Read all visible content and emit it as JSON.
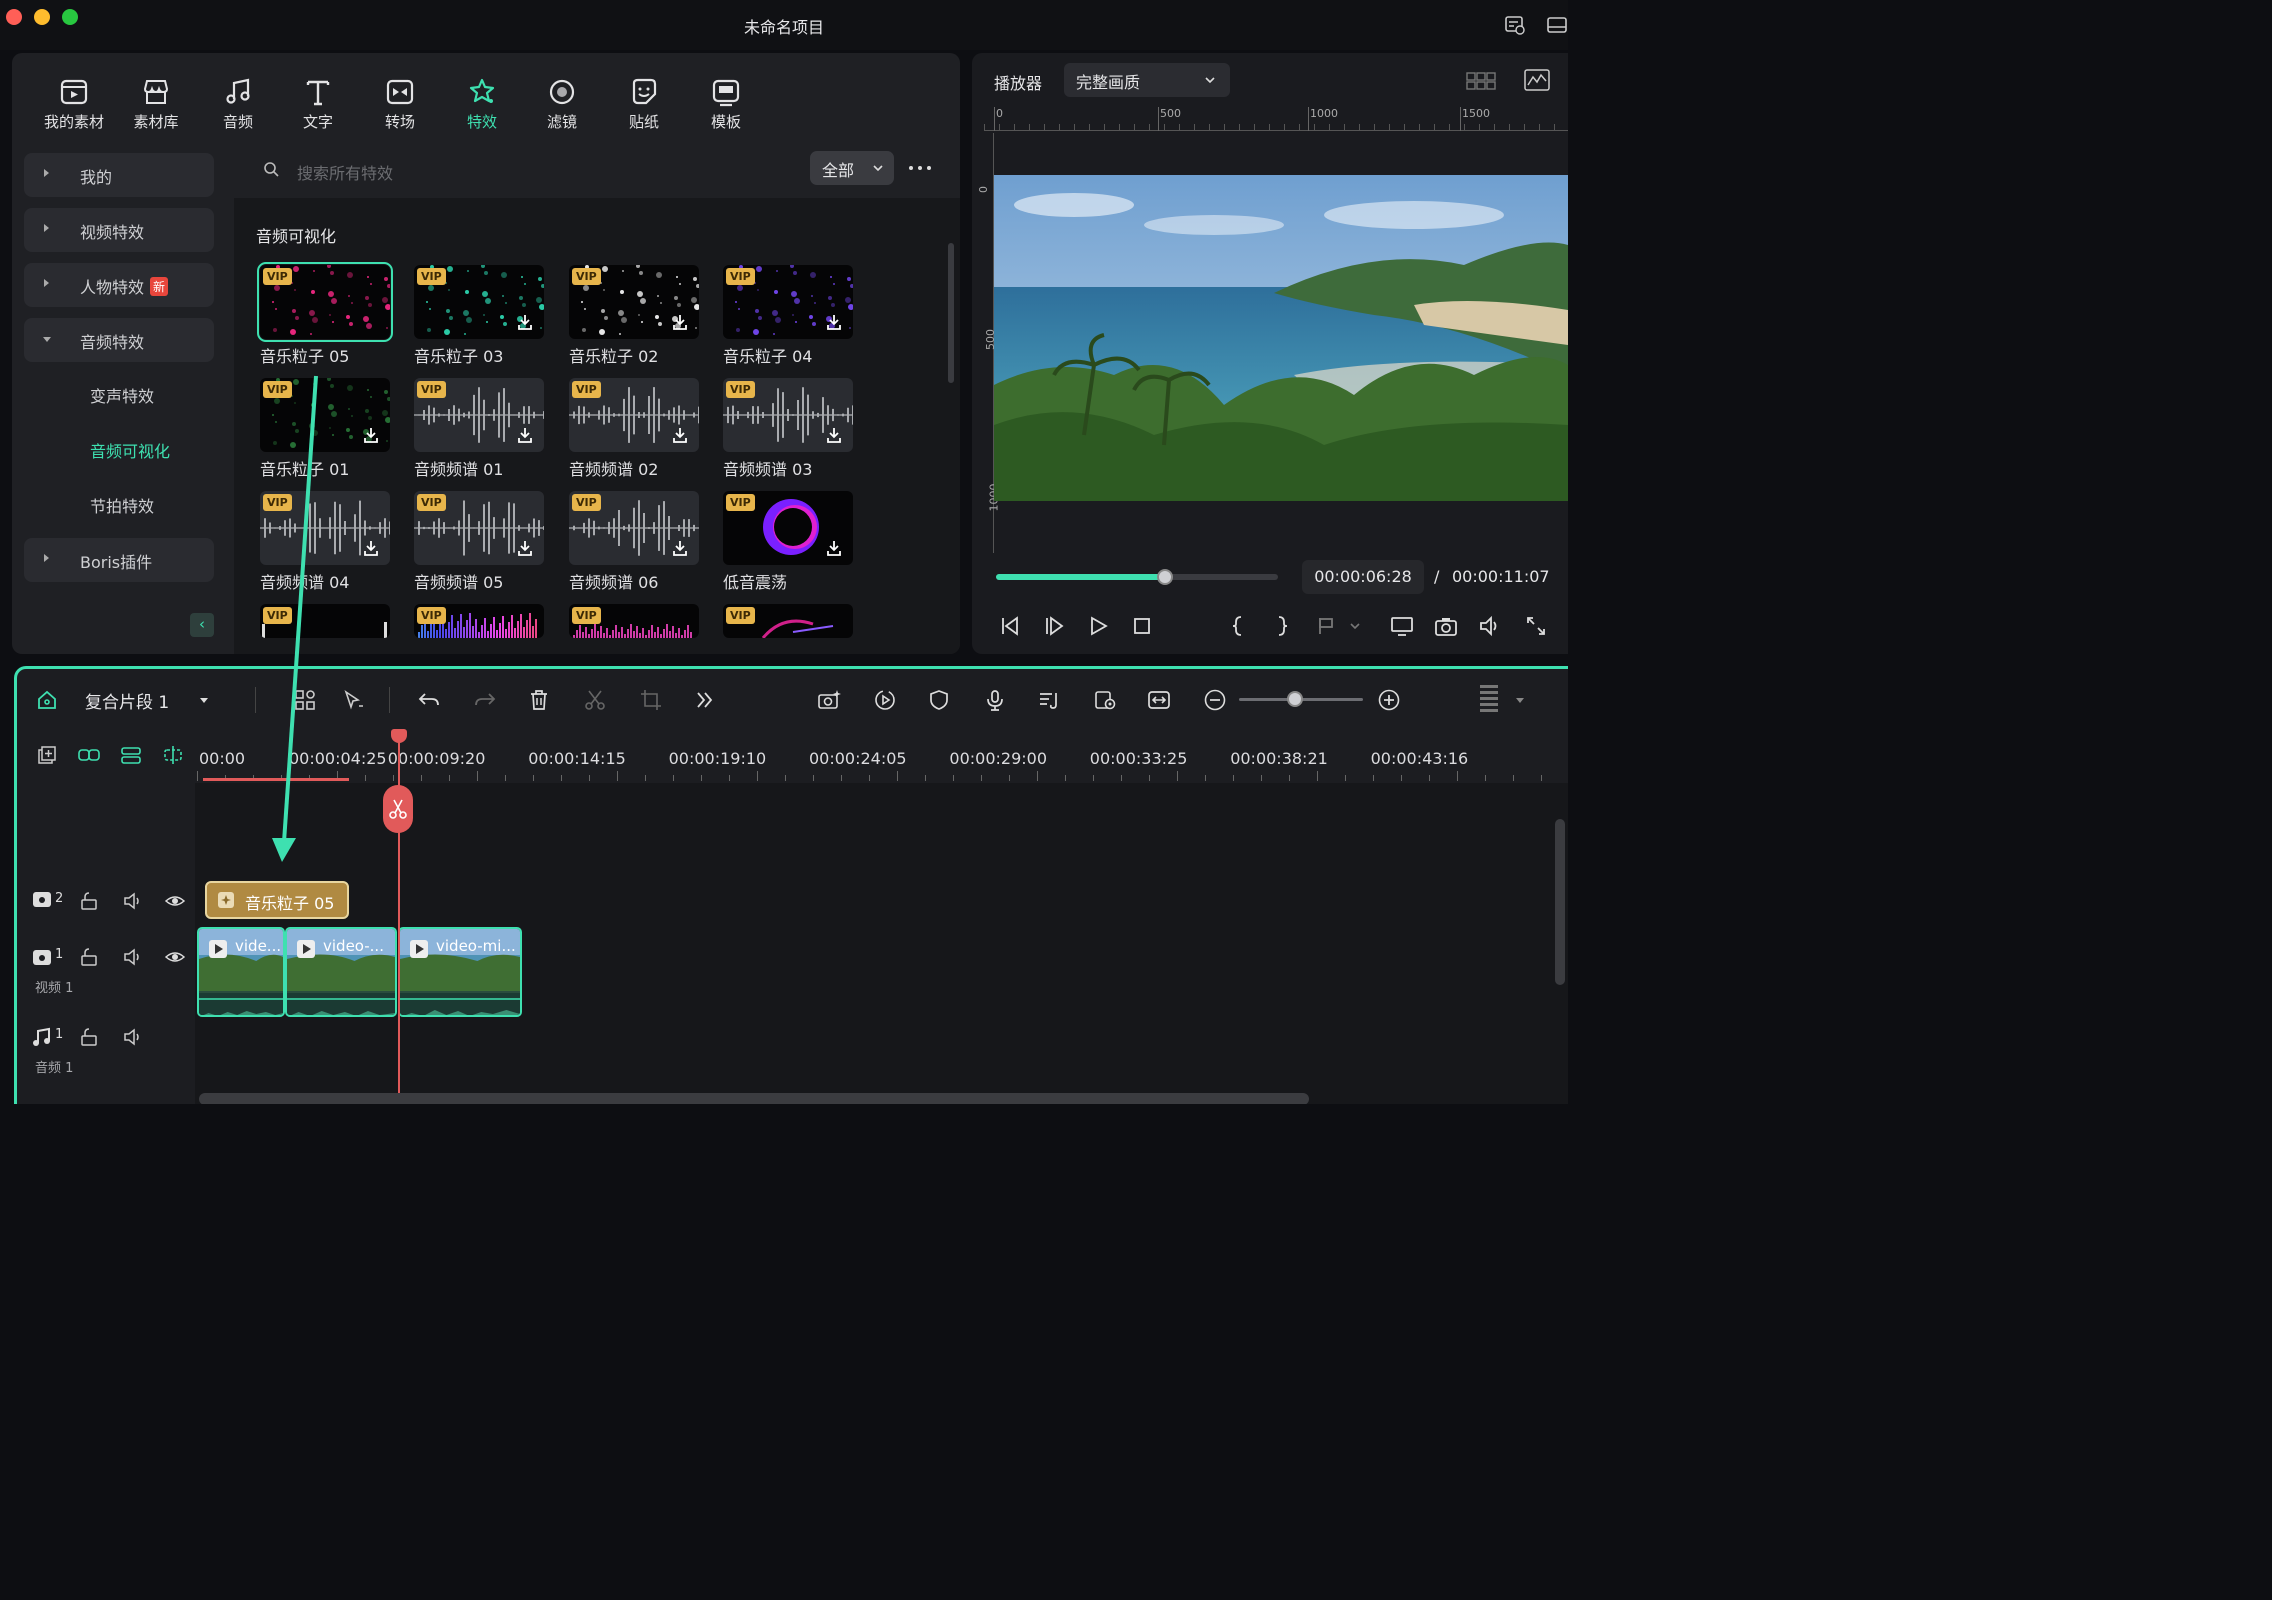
{
  "window": {
    "title": "未命名项目"
  },
  "tabs": [
    {
      "label": "我的素材",
      "icon": "my-media-icon"
    },
    {
      "label": "素材库",
      "icon": "stock-library-icon"
    },
    {
      "label": "音频",
      "icon": "music-note-icon"
    },
    {
      "label": "文字",
      "icon": "text-icon"
    },
    {
      "label": "转场",
      "icon": "transition-icon"
    },
    {
      "label": "特效",
      "icon": "effects-star-icon",
      "active": true
    },
    {
      "label": "滤镜",
      "icon": "filter-icon"
    },
    {
      "label": "贴纸",
      "icon": "sticker-icon"
    },
    {
      "label": "模板",
      "icon": "template-icon"
    }
  ],
  "sidebar": {
    "categories": [
      {
        "label": "我的"
      },
      {
        "label": "视频特效"
      },
      {
        "label": "人物特效",
        "badge": "新"
      },
      {
        "label": "音频特效",
        "expanded": true
      },
      {
        "label": "Boris插件"
      }
    ],
    "subcategories": [
      {
        "label": "变声特效"
      },
      {
        "label": "音频可视化",
        "active": true
      },
      {
        "label": "节拍特效"
      }
    ]
  },
  "search": {
    "placeholder": "搜索所有特效"
  },
  "filter": {
    "label": "全部"
  },
  "section": {
    "title": "音频可视化"
  },
  "effects": [
    {
      "name": "音乐粒子 05",
      "vip": "VIP",
      "selected": true
    },
    {
      "name": "音乐粒子 03",
      "vip": "VIP"
    },
    {
      "name": "音乐粒子 02",
      "vip": "VIP"
    },
    {
      "name": "音乐粒子 04",
      "vip": "VIP"
    },
    {
      "name": "音乐粒子 01",
      "vip": "VIP"
    },
    {
      "name": "音频频谱 01",
      "vip": "VIP"
    },
    {
      "name": "音频频谱 02",
      "vip": "VIP"
    },
    {
      "name": "音频频谱 03",
      "vip": "VIP"
    },
    {
      "name": "音频频谱 04",
      "vip": "VIP"
    },
    {
      "name": "音频频谱 05",
      "vip": "VIP"
    },
    {
      "name": "音频频谱 06",
      "vip": "VIP"
    },
    {
      "name": "低音震荡",
      "vip": "VIP"
    },
    {
      "name": "",
      "vip": "VIP"
    },
    {
      "name": "",
      "vip": "VIP"
    },
    {
      "name": "",
      "vip": "VIP"
    },
    {
      "name": "",
      "vip": "VIP"
    }
  ],
  "player": {
    "label": "播放器",
    "quality": "完整画质",
    "ruler_h": [
      "0",
      "500",
      "1000",
      "1500"
    ],
    "ruler_v": [
      "0",
      "500",
      "1000"
    ],
    "current_time": "00:00:06:28",
    "separator": "/",
    "total_time": "00:00:11:07",
    "progress": 0.6
  },
  "timeline": {
    "title": "复合片段 1",
    "ruler": [
      "00:00",
      "00:00:04:25",
      "00:00:09:20",
      "00:00:14:15",
      "00:00:19:10",
      "00:00:24:05",
      "00:00:29:00",
      "00:00:33:25",
      "00:00:38:21",
      "00:00:43:16"
    ],
    "tracks": [
      {
        "id": "2",
        "label": ""
      },
      {
        "id": "1",
        "label": "视频 1"
      },
      {
        "id": "1",
        "label": "音频 1"
      }
    ],
    "effect_clip": "音乐粒子 05",
    "video_clips": [
      "vide...",
      "video-...",
      "video-mi..."
    ],
    "zoom": 0.45
  },
  "colors": {
    "accent": "#3ee0b0",
    "playhead": "#e15a5a",
    "vip": "#e7b54b",
    "effect_clip": "#b08a42"
  }
}
